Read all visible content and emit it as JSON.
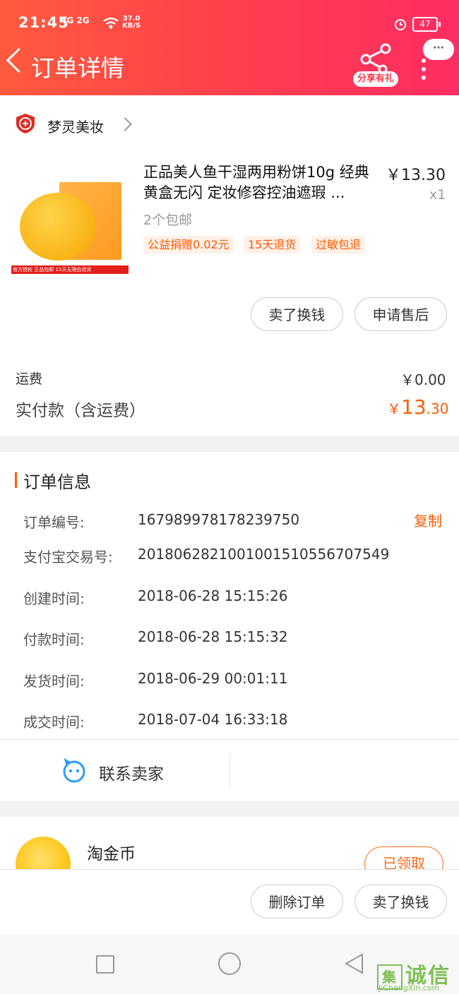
{
  "status_bar": {
    "time": "21:45",
    "network": "4G 2G",
    "speed_value": "37.0",
    "speed_unit": "KB/S",
    "battery": "47"
  },
  "header": {
    "title": "订单详情",
    "share_label": "分享有礼",
    "bubble": "···"
  },
  "shop": {
    "name": "梦灵美妆"
  },
  "product": {
    "title": "正品美人鱼干湿两用粉饼10g 经典黄盒无闪 定妆修容控油遮瑕 ...",
    "price": "￥13.30",
    "qty": "x1",
    "shipping_tag": "2个包邮",
    "tags": [
      "公益捐赠0.02元",
      "15天退货",
      "过敏包退"
    ],
    "thumb_strip": "官方授权 正品包邮 15天无理由退货"
  },
  "item_actions": {
    "sell_exchange": "卖了换钱",
    "after_sale": "申请售后"
  },
  "fees": {
    "freight_label": "运费",
    "freight_value": "￥0.00",
    "paid_label": "实付款（含运费）",
    "paid_currency": "￥",
    "paid_int": "13",
    "paid_dec": ".30"
  },
  "order_info": {
    "title": "订单信息",
    "copy_label": "复制",
    "rows": [
      {
        "label": "订单编号:",
        "value": "167989978178239750"
      },
      {
        "label": "支付宝交易号:",
        "value": "2018062821001001510556707549"
      },
      {
        "label": "创建时间:",
        "value": "2018-06-28 15:15:26"
      },
      {
        "label": "付款时间:",
        "value": "2018-06-28 15:15:32"
      },
      {
        "label": "发货时间:",
        "value": "2018-06-29 00:01:11"
      },
      {
        "label": "成交时间:",
        "value": "2018-07-04 16:33:18"
      }
    ]
  },
  "contact": {
    "label": "联系卖家"
  },
  "coins": {
    "title": "淘金币",
    "claimed": "已领取"
  },
  "bottom_actions": {
    "delete_order": "删除订单",
    "sell_exchange": "卖了换钱"
  },
  "watermark": {
    "text": "诚信",
    "sub": "JiChengXin.com"
  },
  "colors": {
    "accent": "#ff5a00",
    "header_start": "#ff5a3d",
    "header_end": "#ff2d63"
  }
}
